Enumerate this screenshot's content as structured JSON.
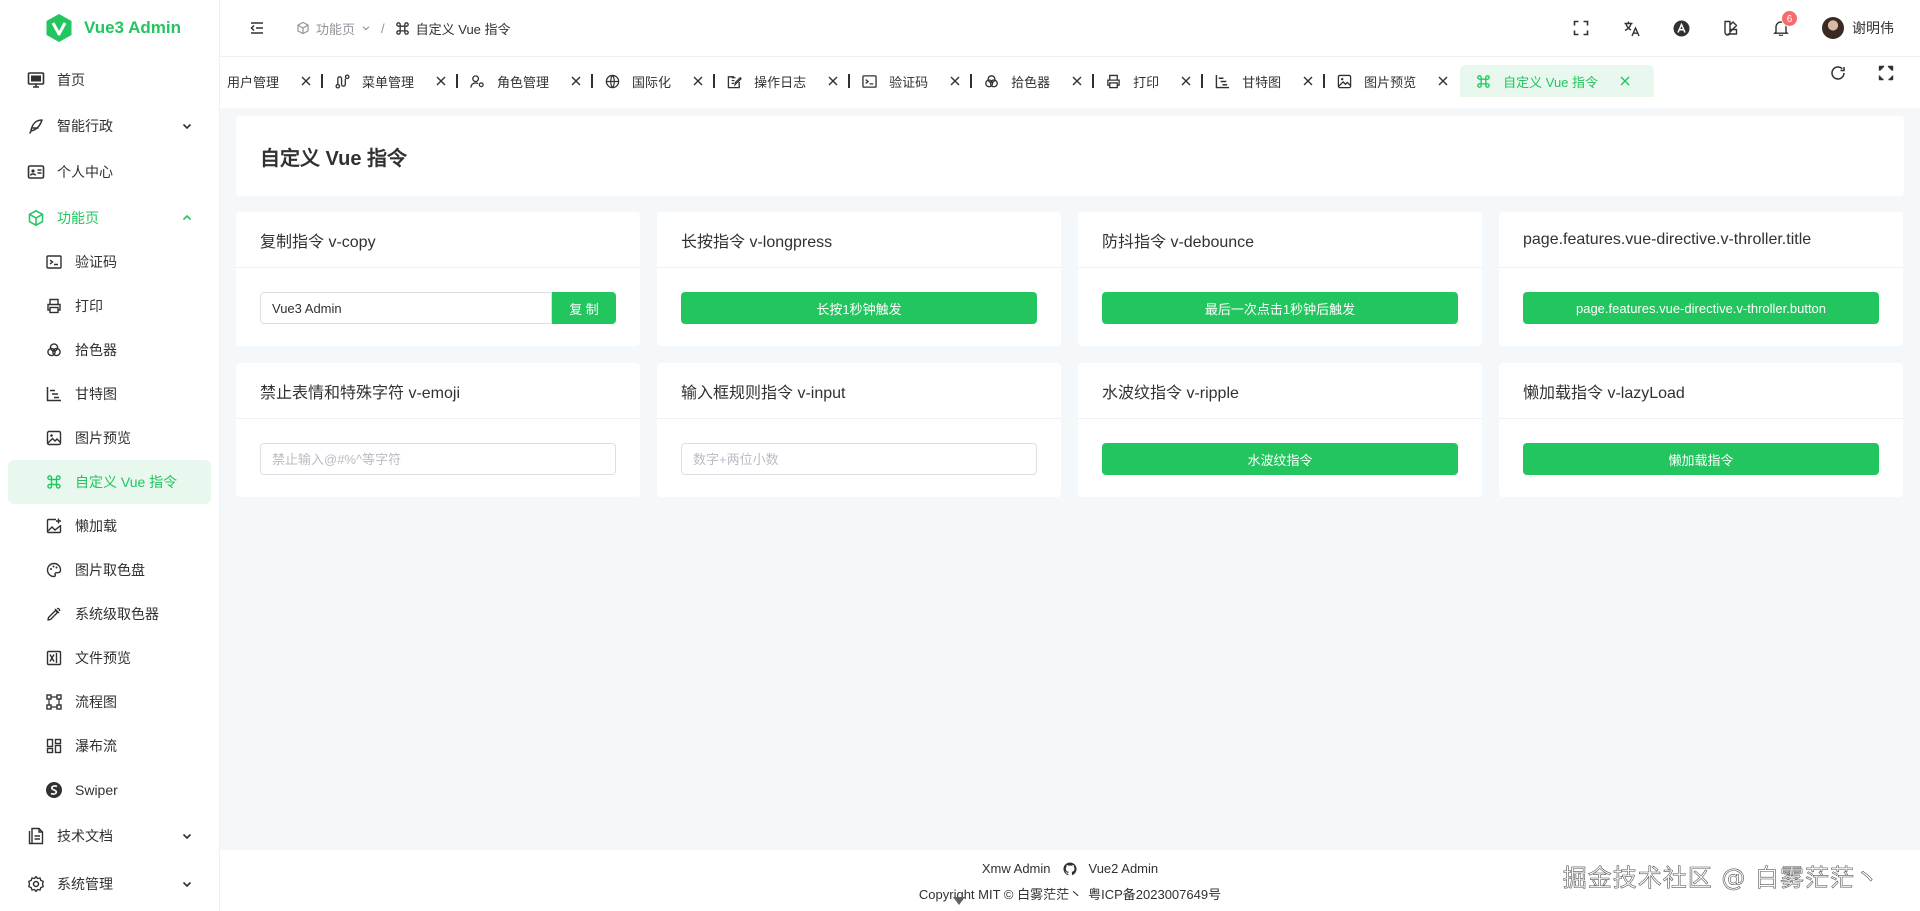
{
  "app": {
    "logo_text": "Vue3 Admin",
    "accent": "#22c55e"
  },
  "sidebar": {
    "items": [
      {
        "label": "首页",
        "icon": "monitor-icon"
      },
      {
        "label": "智能行政",
        "icon": "feather-icon",
        "expandable": true
      },
      {
        "label": "个人中心",
        "icon": "id-card-icon"
      },
      {
        "label": "功能页",
        "icon": "package-icon",
        "expandable": true,
        "open": true
      }
    ],
    "sub_items": [
      {
        "label": "验证码",
        "icon": "terminal-icon"
      },
      {
        "label": "打印",
        "icon": "printer-icon"
      },
      {
        "label": "拾色器",
        "icon": "palette-circles-icon"
      },
      {
        "label": "甘特图",
        "icon": "gantt-icon"
      },
      {
        "label": "图片预览",
        "icon": "image-icon"
      },
      {
        "label": "自定义 Vue 指令",
        "icon": "command-icon",
        "active": true
      },
      {
        "label": "懒加载",
        "icon": "image-plus-icon"
      },
      {
        "label": "图片取色盘",
        "icon": "palette-icon"
      },
      {
        "label": "系统级取色器",
        "icon": "pipette-icon"
      },
      {
        "label": "文件预览",
        "icon": "excel-icon"
      },
      {
        "label": "流程图",
        "icon": "workflow-icon"
      },
      {
        "label": "瀑布流",
        "icon": "layout-grid-icon"
      },
      {
        "label": "Swiper",
        "icon": "swiper-icon"
      }
    ],
    "bottom_items": [
      {
        "label": "技术文档",
        "icon": "document-icon"
      },
      {
        "label": "系统管理",
        "icon": "settings-icon"
      }
    ]
  },
  "header": {
    "breadcrumb_parent": "功能页",
    "breadcrumb_sep": "/",
    "breadcrumb_current": "自定义 Vue 指令",
    "notification_count": "6",
    "user_name": "谢明伟"
  },
  "tabs": [
    {
      "label": "用户管理",
      "icon": ""
    },
    {
      "label": "菜单管理",
      "icon": "route-icon"
    },
    {
      "label": "角色管理",
      "icon": "user-cog-icon"
    },
    {
      "label": "国际化",
      "icon": "globe-icon"
    },
    {
      "label": "操作日志",
      "icon": "edit-icon"
    },
    {
      "label": "验证码",
      "icon": "terminal-icon"
    },
    {
      "label": "拾色器",
      "icon": "palette-circles-icon"
    },
    {
      "label": "打印",
      "icon": "printer-icon"
    },
    {
      "label": "甘特图",
      "icon": "gantt-icon"
    },
    {
      "label": "图片预览",
      "icon": "image-icon"
    },
    {
      "label": "自定义 Vue 指令",
      "icon": "command-icon",
      "active": true
    }
  ],
  "main": {
    "title": "自定义 Vue 指令",
    "cards": [
      {
        "title": "复制指令 v-copy",
        "kind": "copy",
        "input_value": "Vue3 Admin",
        "button": "复 制"
      },
      {
        "title": "长按指令 v-longpress",
        "kind": "button",
        "button": "长按1秒钟触发"
      },
      {
        "title": "防抖指令 v-debounce",
        "kind": "button",
        "button": "最后一次点击1秒钟后触发"
      },
      {
        "title": "page.features.vue-directive.v-throller.title",
        "kind": "button",
        "button": "page.features.vue-directive.v-throller.button"
      },
      {
        "title": "禁止表情和特殊字符 v-emoji",
        "kind": "input",
        "placeholder": "禁止输入@#%^等字符"
      },
      {
        "title": "输入框规则指令 v-input",
        "kind": "input",
        "placeholder": "数字+两位小数"
      },
      {
        "title": "水波纹指令 v-ripple",
        "kind": "button",
        "button": "水波纹指令"
      },
      {
        "title": "懒加载指令 v-lazyLoad",
        "kind": "button",
        "button": "懒加载指令"
      }
    ]
  },
  "footer": {
    "line1_left": "Xmw Admin",
    "line1_right": "Vue2 Admin",
    "line2_copyright": "Copyright MIT © 白雾茫茫丶",
    "line2_icp": "粤ICP备2023007649号"
  },
  "watermark": "掘金技术社区 @ 白雾茫茫丶"
}
